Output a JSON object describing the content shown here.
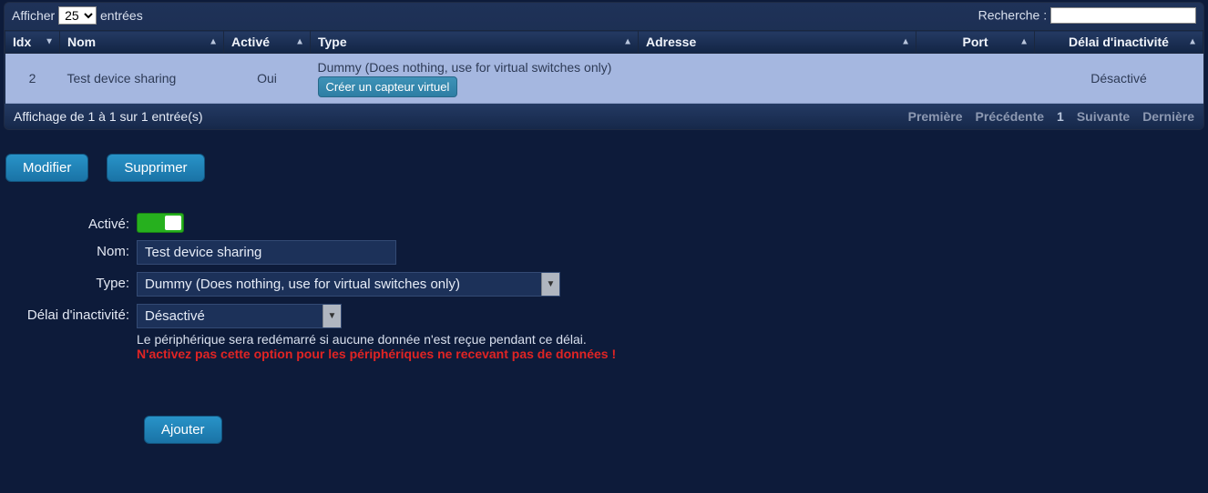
{
  "length": {
    "prefix": "Afficher",
    "value": "25",
    "suffix": "entrées"
  },
  "search": {
    "label": "Recherche :",
    "value": ""
  },
  "columns": {
    "idx": "Idx",
    "nom": "Nom",
    "active": "Activé",
    "type": "Type",
    "adresse": "Adresse",
    "port": "Port",
    "delai": "Délai d'inactivité"
  },
  "row": {
    "idx": "2",
    "nom": "Test device sharing",
    "active": "Oui",
    "type_text": "Dummy (Does nothing, use for virtual switches only)",
    "create_btn": "Créer un capteur virtuel",
    "adresse": "",
    "port": "",
    "delai": "Désactivé"
  },
  "info_text": "Affichage de 1 à 1 sur 1 entrée(s)",
  "pager": {
    "first": "Première",
    "prev": "Précédente",
    "page": "1",
    "next": "Suivante",
    "last": "Dernière"
  },
  "buttons": {
    "modify": "Modifier",
    "delete": "Supprimer",
    "add": "Ajouter"
  },
  "form": {
    "active_label": "Activé:",
    "nom_label": "Nom:",
    "nom_value": "Test device sharing",
    "type_label": "Type:",
    "type_value": "Dummy (Does nothing, use for virtual switches only)",
    "delai_label": "Délai d'inactivité:",
    "delai_value": "Désactivé",
    "delai_hint": "Le périphérique sera redémarré si aucune donnée n'est reçue pendant ce délai.",
    "delai_warn": "N'activez pas cette option pour les périphériques ne recevant pas de données !"
  }
}
